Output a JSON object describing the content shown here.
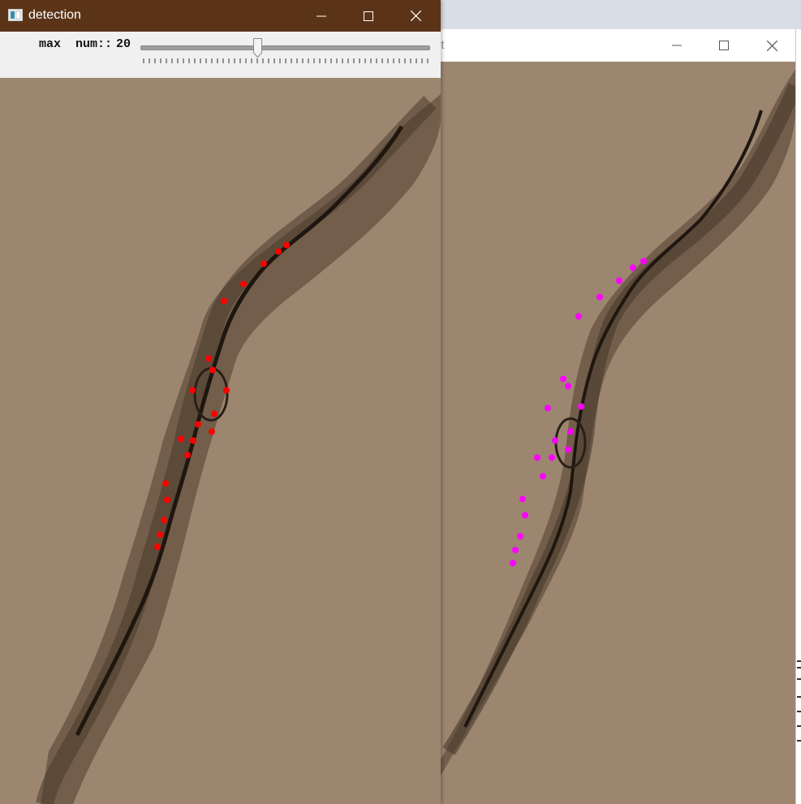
{
  "windows": {
    "detection": {
      "title": "detection",
      "trackbar": {
        "label": "max  num::",
        "value": "20",
        "max": 50
      },
      "points_color": "#ff0000"
    },
    "second": {
      "title_fragment": "nt",
      "points_color": "#ff00ff"
    }
  },
  "colors": {
    "titlebar_active": "#5b3418",
    "ground": "#9c8670",
    "crack": "#2a1f17"
  },
  "icons": [
    "app-icon",
    "minimize-icon",
    "maximize-icon",
    "close-icon"
  ]
}
